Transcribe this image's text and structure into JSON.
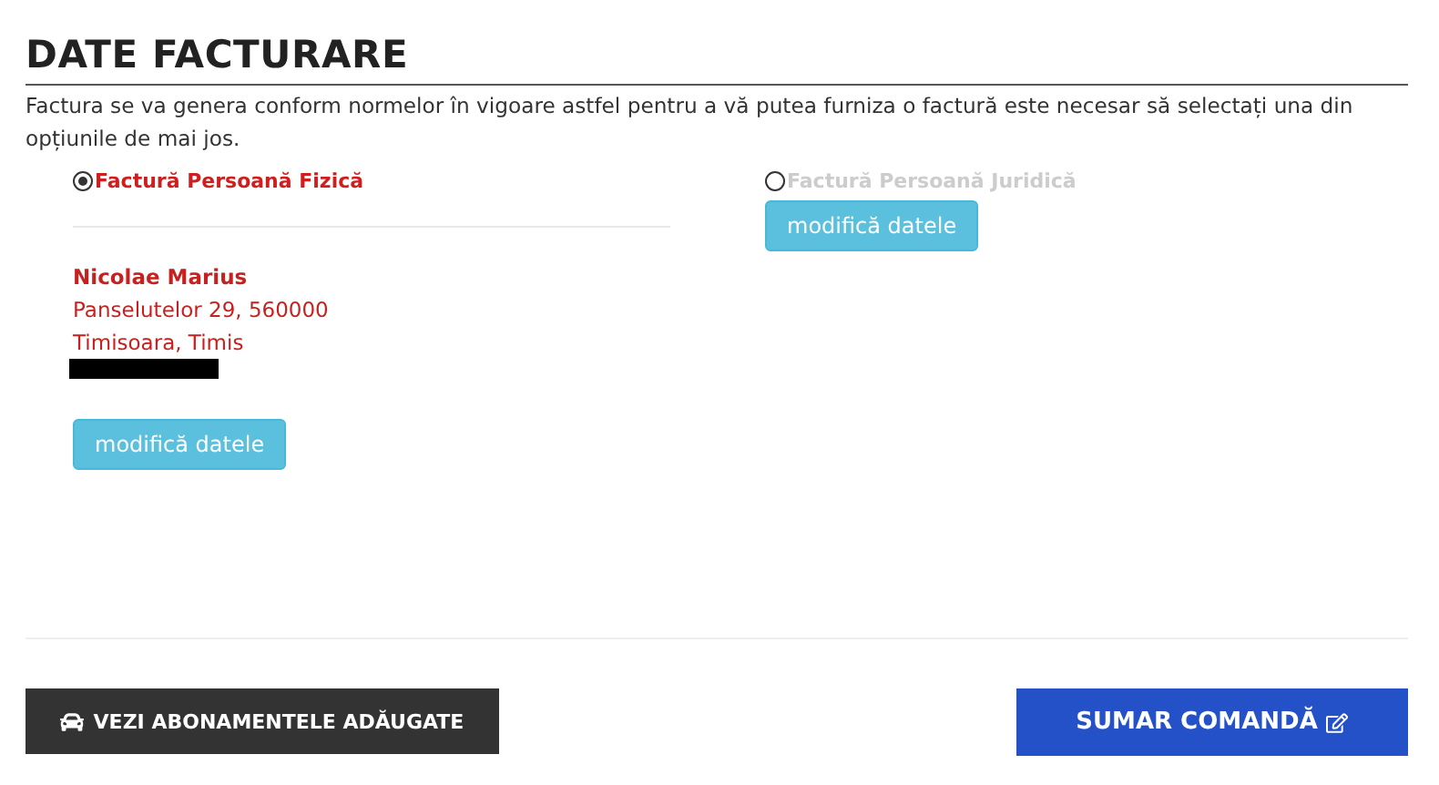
{
  "title": "DATE FACTURARE",
  "intro": "Factura se va genera conform normelor în vigoare astfel pentru a vă putea furniza o factură este necesar să selectați una din opțiunile de mai jos.",
  "options": [
    {
      "label": "Factură Persoană Fizică",
      "selected": true,
      "details": {
        "name": "Nicolae Marius",
        "lines": [
          "Panselutelor 29, 560000",
          "Timisoara, Timis"
        ],
        "redacted": true
      },
      "button": "modifică datele"
    },
    {
      "label": "Factură Persoană Juridică",
      "selected": false,
      "button": "modifică datele"
    }
  ],
  "footer": {
    "back": "VEZI ABONAMENTELE ADĂUGATE",
    "next": "SUMAR COMANDĂ"
  }
}
